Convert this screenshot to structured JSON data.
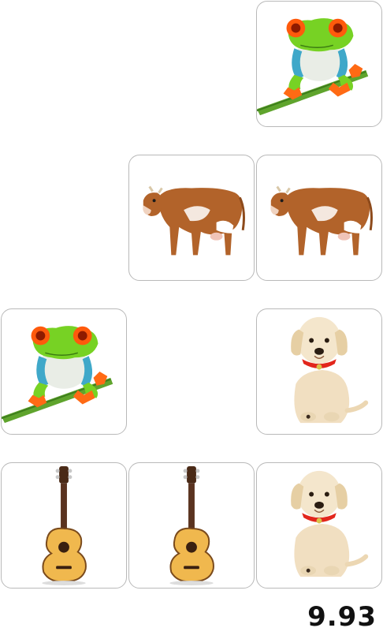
{
  "game": {
    "timer": "9.93",
    "grid": {
      "columns": 3,
      "rows": 4
    },
    "cards": [
      {
        "row": 0,
        "col": 2,
        "face": "frog"
      },
      {
        "row": 1,
        "col": 1,
        "face": "cow"
      },
      {
        "row": 1,
        "col": 2,
        "face": "cow"
      },
      {
        "row": 2,
        "col": 0,
        "face": "frog"
      },
      {
        "row": 2,
        "col": 2,
        "face": "puppy"
      },
      {
        "row": 3,
        "col": 0,
        "face": "guitar"
      },
      {
        "row": 3,
        "col": 1,
        "face": "guitar"
      },
      {
        "row": 3,
        "col": 2,
        "face": "puppy"
      }
    ],
    "icons": {
      "frog": "frog-icon",
      "cow": "cow-icon",
      "puppy": "puppy-icon",
      "guitar": "guitar-icon"
    }
  }
}
